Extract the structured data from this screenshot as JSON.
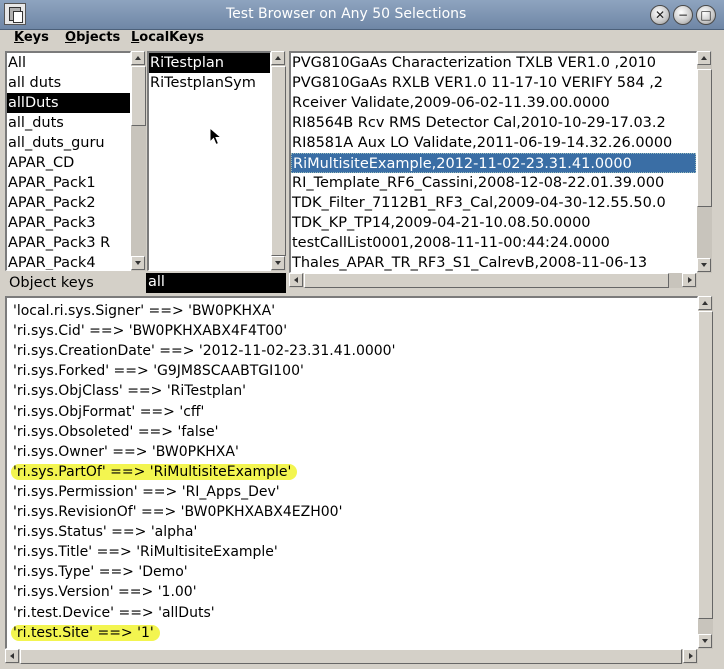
{
  "window": {
    "title": "Test Browser on  Any 50 Selections"
  },
  "title_buttons": {
    "close": "✕",
    "minimize": "−",
    "maximize": "□"
  },
  "menu": [
    {
      "label": "Keys",
      "underline": "K"
    },
    {
      "label": "Objects",
      "underline": "O"
    },
    {
      "label": "LocalKeys",
      "underline": "L"
    }
  ],
  "keys_list": {
    "items": [
      "All",
      "all duts",
      "allDuts",
      "all_duts",
      "all_duts_guru",
      "APAR_CD",
      "APAR_Pack1",
      "APAR_Pack2",
      "APAR_Pack3",
      "APAR_Pack3 R",
      "APAR_Pack4"
    ],
    "selected_index": 2
  },
  "class_list": {
    "items": [
      "RiTestplan",
      "RiTestplanSym"
    ],
    "selected_index": 0
  },
  "objects_list": {
    "items": [
      "PVG810GaAs Characterization TXLB VER1.0 ,2010",
      "PVG810GaAs RXLB VER1.0 11-17-10 VERIFY 584 ,2",
      "Rceiver Validate,2009-06-02-11.39.00.0000",
      "RI8564B Rcv RMS Detector Cal,2010-10-29-17.03.2",
      "RI8581A Aux LO Validate,2011-06-19-14.32.26.0000",
      "RiMultisiteExample,2012-11-02-23.31.41.0000",
      "RI_Template_RF6_Cassini,2008-12-08-22.01.39.000",
      "TDK_Filter_7112B1_RF3_Cal,2009-04-30-12.55.50.0",
      "TDK_KP_TP14,2009-04-21-10.08.50.0000",
      "testCallList0001,2008-11-11-00:44:24.0000",
      "Thales_APAR_TR_RF3_S1_CalrevB,2008-11-06-13",
      "Thales_APAR_TR_RF3_S1_Val,2008-11-04-13.15.1"
    ],
    "selected_index": 5
  },
  "object_keys": {
    "label": "Object keys",
    "value": "all"
  },
  "attributes": [
    {
      "text": "'local.ri.sys.Signer' ==> 'BW0PKHXA'",
      "highlight": false
    },
    {
      "text": "'ri.sys.Cid' ==> 'BW0PKHXABX4F4T00'",
      "highlight": false
    },
    {
      "text": "'ri.sys.CreationDate' ==> '2012-11-02-23.31.41.0000'",
      "highlight": false
    },
    {
      "text": "'ri.sys.Forked' ==> 'G9JM8SCAABTGI100'",
      "highlight": false
    },
    {
      "text": "'ri.sys.ObjClass' ==> 'RiTestplan'",
      "highlight": false
    },
    {
      "text": "'ri.sys.ObjFormat' ==> 'cff'",
      "highlight": false
    },
    {
      "text": "'ri.sys.Obsoleted' ==> 'false'",
      "highlight": false
    },
    {
      "text": "'ri.sys.Owner' ==> 'BW0PKHXA'",
      "highlight": false
    },
    {
      "text": "'ri.sys.PartOf' ==> 'RiMultisiteExample'",
      "highlight": true
    },
    {
      "text": "'ri.sys.Permission' ==> 'RI_Apps_Dev'",
      "highlight": false
    },
    {
      "text": "'ri.sys.RevisionOf' ==> 'BW0PKHXABX4EZH00'",
      "highlight": false
    },
    {
      "text": "'ri.sys.Status' ==> 'alpha'",
      "highlight": false
    },
    {
      "text": "'ri.sys.Title' ==> 'RiMultisiteExample'",
      "highlight": false
    },
    {
      "text": "'ri.sys.Type' ==> 'Demo'",
      "highlight": false
    },
    {
      "text": "'ri.sys.Version' ==> '1.00'",
      "highlight": false
    },
    {
      "text": "'ri.test.Device' ==> 'allDuts'",
      "highlight": false
    },
    {
      "text": "'ri.test.Site' ==> '1'",
      "highlight": true
    }
  ],
  "colors": {
    "titlebar": "#7a90ad",
    "selection_black": "#000000",
    "selection_blue": "#3a6ea5",
    "highlight": "#f3f550"
  }
}
